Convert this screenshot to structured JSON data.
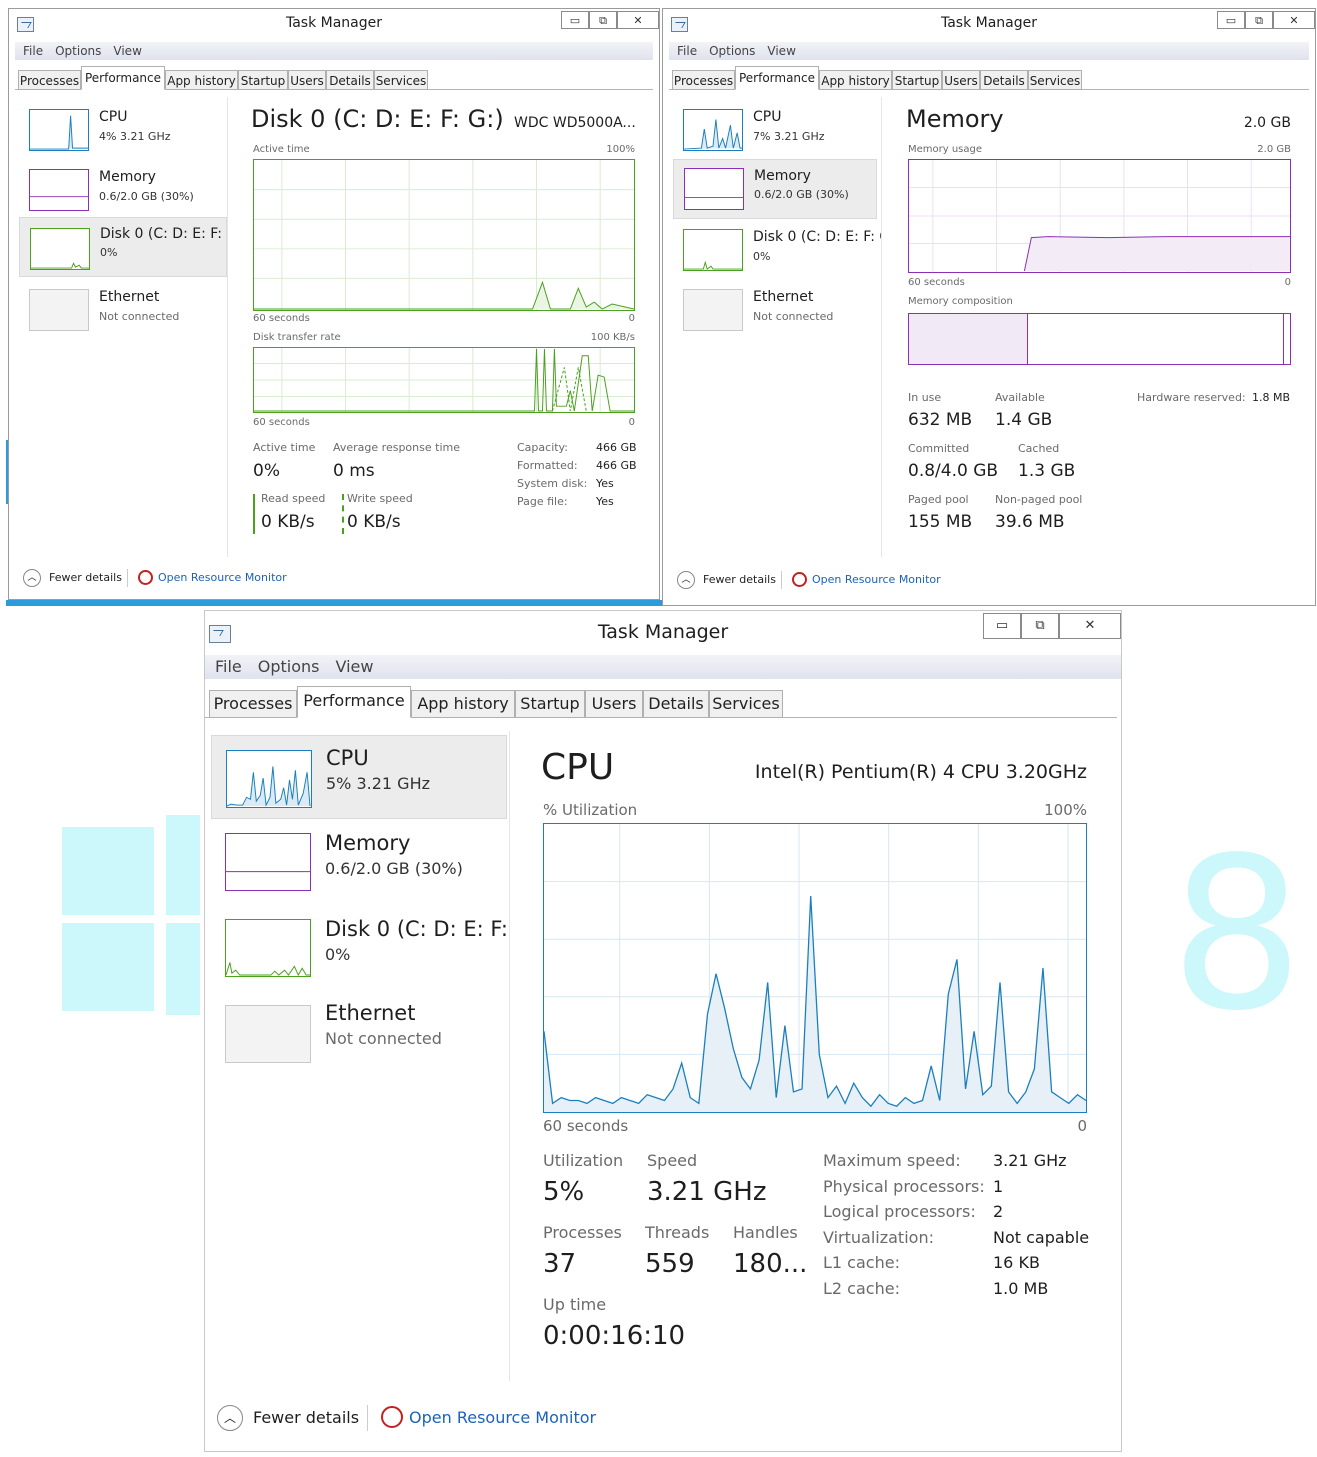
{
  "window_title": "Task Manager",
  "window_controls": {
    "minimize": "▭",
    "restore": "⧉",
    "close": "✕"
  },
  "menu": [
    "File",
    "Options",
    "View"
  ],
  "tabs": [
    "Processes",
    "Performance",
    "App history",
    "Startup",
    "Users",
    "Details",
    "Services"
  ],
  "sidebar": {
    "cpu": {
      "name": "CPU"
    },
    "memory": {
      "name": "Memory",
      "sub": "0.6/2.0 GB (30%)"
    },
    "disk": {
      "name": "Disk 0 (C: D: E: F: G:)",
      "sub": "0%"
    },
    "ethernet": {
      "name": "Ethernet",
      "sub": "Not connected"
    }
  },
  "footer": {
    "fewer_details": "Fewer details",
    "open_resource_monitor": "Open Resource Monitor"
  },
  "colors": {
    "cpu": "#1a7fbf",
    "memory": "#8b2fb7",
    "disk": "#4aa11e",
    "link": "#1c62b9"
  },
  "win_disk": {
    "cpu_sub": "4% 3.21 GHz",
    "title": "Disk 0 (C: D: E: F: G:)",
    "model": "WDC WD5000A...",
    "active_time_label": "Active time",
    "active_time_max": "100%",
    "seconds_label": "60 seconds",
    "zero": "0",
    "transfer_label": "Disk transfer rate",
    "transfer_max": "100 KB/s",
    "stats": {
      "active_time": {
        "label": "Active time",
        "value": "0%"
      },
      "avg_response": {
        "label": "Average response time",
        "value": "0 ms"
      },
      "read_speed": {
        "label": "Read speed",
        "value": "0 KB/s"
      },
      "write_speed": {
        "label": "Write speed",
        "value": "0 KB/s"
      }
    },
    "info": [
      {
        "label": "Capacity:",
        "value": "466 GB"
      },
      {
        "label": "Formatted:",
        "value": "466 GB"
      },
      {
        "label": "System disk:",
        "value": "Yes"
      },
      {
        "label": "Page file:",
        "value": "Yes"
      }
    ]
  },
  "win_memory": {
    "cpu_sub": "7% 3.21 GHz",
    "title": "Memory",
    "total": "2.0 GB",
    "usage_label": "Memory usage",
    "usage_max": "2.0 GB",
    "seconds_label": "60 seconds",
    "zero": "0",
    "composition_label": "Memory composition",
    "stats": {
      "in_use": {
        "label": "In use",
        "value": "632 MB"
      },
      "available": {
        "label": "Available",
        "value": "1.4 GB"
      },
      "hw_reserved": {
        "label": "Hardware reserved:",
        "value": "1.8 MB"
      },
      "committed": {
        "label": "Committed",
        "value": "0.8/4.0 GB"
      },
      "cached": {
        "label": "Cached",
        "value": "1.3 GB"
      },
      "paged_pool": {
        "label": "Paged pool",
        "value": "155 MB"
      },
      "non_paged_pool": {
        "label": "Non-paged pool",
        "value": "39.6 MB"
      }
    }
  },
  "win_cpu": {
    "cpu_sub": "5% 3.21 GHz",
    "title": "CPU",
    "model": "Intel(R) Pentium(R) 4 CPU 3.20GHz",
    "util_label": "% Utilization",
    "util_max": "100%",
    "seconds_label": "60 seconds",
    "zero": "0",
    "stats": {
      "utilization": {
        "label": "Utilization",
        "value": "5%"
      },
      "speed": {
        "label": "Speed",
        "value": "3.21 GHz"
      },
      "processes": {
        "label": "Processes",
        "value": "37"
      },
      "threads": {
        "label": "Threads",
        "value": "559"
      },
      "handles": {
        "label": "Handles",
        "value": "180..."
      },
      "uptime": {
        "label": "Up time",
        "value": "0:00:16:10"
      }
    },
    "info": [
      {
        "label": "Maximum speed:",
        "value": "3.21 GHz"
      },
      {
        "label": "Physical processors:",
        "value": "1"
      },
      {
        "label": "Logical processors:",
        "value": "2"
      },
      {
        "label": "Virtualization:",
        "value": "Not capable"
      },
      {
        "label": "L1 cache:",
        "value": "16 KB"
      },
      {
        "label": "L2 cache:",
        "value": "1.0 MB"
      }
    ],
    "utilization_series": [
      28,
      3,
      5,
      4,
      4,
      3,
      5,
      4,
      3,
      5,
      4,
      3,
      6,
      5,
      4,
      8,
      17,
      5,
      3,
      34,
      48,
      36,
      22,
      12,
      8,
      18,
      45,
      5,
      30,
      7,
      8,
      75,
      20,
      5,
      9,
      3,
      10,
      5,
      2,
      6,
      3,
      2,
      5,
      3,
      4,
      16,
      4,
      41,
      53,
      8,
      28,
      6,
      9,
      45,
      7,
      3,
      7,
      15,
      50,
      7,
      5,
      3,
      6,
      4
    ],
    "ylim": [
      0,
      100
    ]
  }
}
